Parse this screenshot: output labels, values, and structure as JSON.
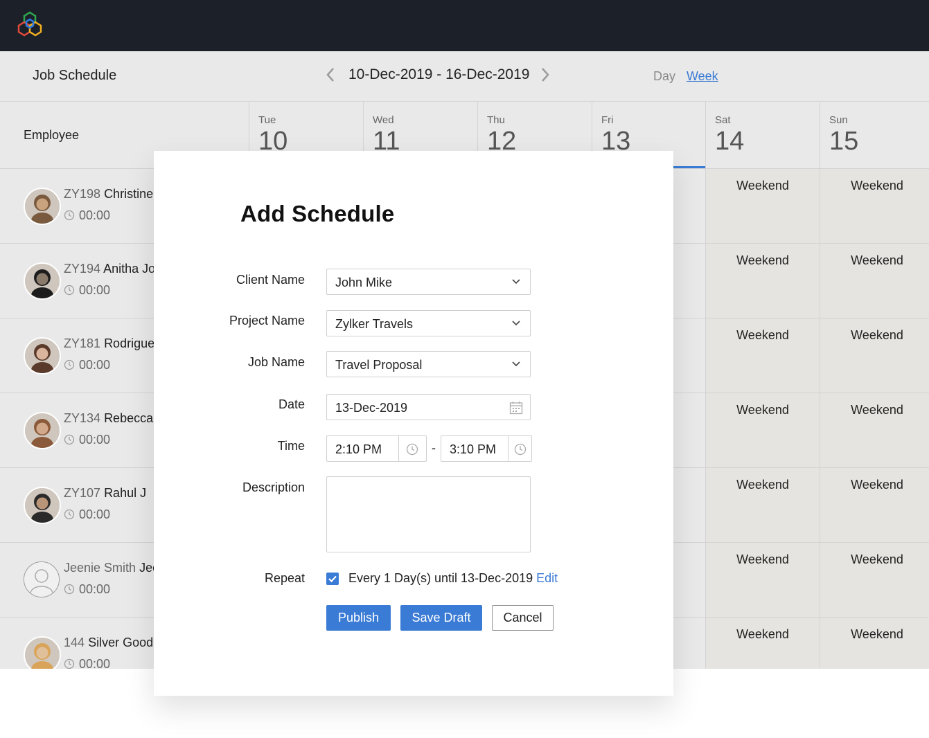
{
  "header": {
    "title": "Job Schedule",
    "date_range": "10-Dec-2019 - 16-Dec-2019",
    "view_day": "Day",
    "view_week": "Week"
  },
  "grid": {
    "employee_header": "Employee",
    "days": [
      {
        "name": "Tue",
        "num": "10"
      },
      {
        "name": "Wed",
        "num": "11"
      },
      {
        "name": "Thu",
        "num": "12"
      },
      {
        "name": "Fri",
        "num": "13"
      },
      {
        "name": "Sat",
        "num": "14"
      },
      {
        "name": "Sun",
        "num": "15"
      }
    ],
    "weekend_label": "Weekend",
    "employees": [
      {
        "id": "ZY198",
        "name": "Christine",
        "time": "00:00"
      },
      {
        "id": "ZY194",
        "name": "Anitha Jo",
        "time": "00:00"
      },
      {
        "id": "ZY181",
        "name": "Rodrigue",
        "time": "00:00"
      },
      {
        "id": "ZY134",
        "name": "Rebecca",
        "time": "00:00"
      },
      {
        "id": "ZY107",
        "name": "Rahul J",
        "time": "00:00"
      },
      {
        "id": "Jeenie Smith",
        "name": "Jee",
        "time": "00:00"
      },
      {
        "id": "144",
        "name": "Silver Goodr",
        "time": "00:00"
      }
    ]
  },
  "modal": {
    "title": "Add Schedule",
    "client_label": "Client Name",
    "client_value": "John Mike",
    "project_label": "Project Name",
    "project_value": "Zylker Travels",
    "job_label": "Job Name",
    "job_value": "Travel Proposal",
    "date_label": "Date",
    "date_value": "13-Dec-2019",
    "time_label": "Time",
    "time_from": "2:10 PM",
    "time_separator": "-",
    "time_to": "3:10 PM",
    "description_label": "Description",
    "description_value": "",
    "repeat_label": "Repeat",
    "repeat_checked": true,
    "repeat_text": "Every 1 Day(s) until 13-Dec-2019",
    "repeat_edit": "Edit",
    "publish": "Publish",
    "save_draft": "Save Draft",
    "cancel": "Cancel"
  },
  "colors": {
    "accent": "#3a7bd5",
    "topbar": "#1b2029",
    "weekend_bg": "#e6e4e0"
  }
}
